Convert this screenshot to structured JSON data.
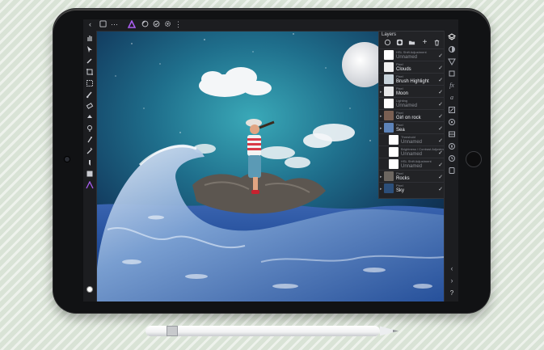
{
  "toolbar": {
    "icons": [
      "back-icon",
      "documents-icon",
      "more-icon",
      "affinity-persona-icon",
      "history-icon",
      "snapping-icon",
      "settings-icon",
      "menu-more-icon"
    ]
  },
  "layers_panel": {
    "title": "Layers",
    "items": [
      {
        "type": "HSL Shift Adjustment",
        "name": "Unnamed",
        "dim": true,
        "indent": false,
        "thumb": "#ffffff",
        "has_caret": false
      },
      {
        "type": "Pixel",
        "name": "Clouds",
        "dim": false,
        "indent": false,
        "thumb": "#f1f1f1",
        "has_caret": false
      },
      {
        "type": "Pixel",
        "name": "Brush Highlight",
        "dim": false,
        "indent": false,
        "thumb": "#c8d3da",
        "has_caret": false
      },
      {
        "type": "Pixel",
        "name": "Moon",
        "dim": false,
        "indent": false,
        "thumb": "#e7e8e9",
        "has_caret": true
      },
      {
        "type": "Lighting",
        "name": "Unnamed",
        "dim": true,
        "indent": false,
        "thumb": "#ffffff",
        "has_caret": false
      },
      {
        "type": "Pixel",
        "name": "Girl on rock",
        "dim": false,
        "indent": false,
        "thumb": "#7a5f52",
        "has_caret": true
      },
      {
        "type": "Pixel",
        "name": "Sea",
        "dim": false,
        "indent": false,
        "thumb": "#5d83b8",
        "has_caret": true
      },
      {
        "type": "Threshold",
        "name": "Unnamed",
        "dim": true,
        "indent": true,
        "thumb": "#ffffff",
        "has_caret": false
      },
      {
        "type": "Brightness / Contrast Adjustment",
        "name": "Unnamed",
        "dim": true,
        "indent": true,
        "thumb": "#ffffff",
        "has_caret": false
      },
      {
        "type": "HSL Shift Adjustment",
        "name": "Unnamed",
        "dim": true,
        "indent": true,
        "thumb": "#ffffff",
        "has_caret": false
      },
      {
        "type": "Pixel",
        "name": "Rocks",
        "dim": false,
        "indent": false,
        "thumb": "#6c6660",
        "has_caret": true
      },
      {
        "type": "Pixel",
        "name": "Sky",
        "dim": false,
        "indent": false,
        "thumb": "#2c4f7a",
        "has_caret": true
      }
    ]
  },
  "colors": {
    "accent": "#a95ef0",
    "ui_dark": "#1c1d20",
    "panel": "#222326"
  }
}
